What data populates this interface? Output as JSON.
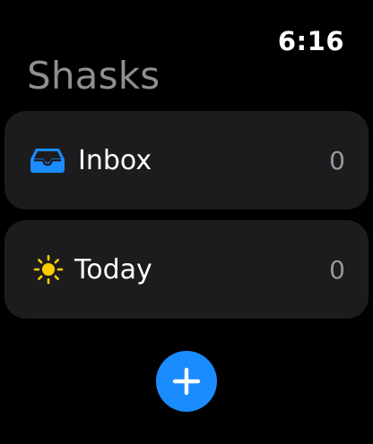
{
  "status": {
    "time": "6:16"
  },
  "header": {
    "title": "Shasks"
  },
  "lists": [
    {
      "label": "Inbox",
      "count": "0",
      "icon": "tray-icon"
    },
    {
      "label": "Today",
      "count": "0",
      "icon": "sun-icon"
    }
  ],
  "actions": {
    "add_icon": "plus-icon"
  },
  "colors": {
    "background": "#000000",
    "row": "#1c1c1e",
    "accent": "#1a8cff",
    "sun": "#ffcc00",
    "title": "#8e8e93",
    "count": "#98989d"
  }
}
